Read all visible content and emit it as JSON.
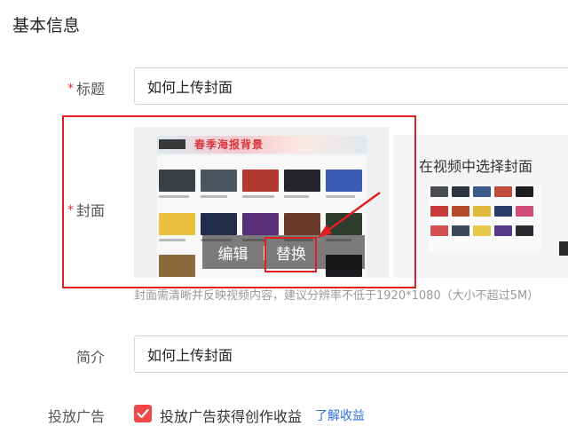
{
  "section": {
    "title": "基本信息"
  },
  "required_mark": "*",
  "title_field": {
    "label": "标题",
    "value": "如何上传封面"
  },
  "cover": {
    "label": "封面",
    "banner_text": "春季海报背景",
    "edit_label": "编辑",
    "replace_label": "替换",
    "tip": "封面需清晰并反映视频内容，建议分辨率不低于1920*1080（大小不超过5M）",
    "video_picker_label": "在视频中选择封面"
  },
  "intro_field": {
    "label": "简介",
    "value": "如何上传封面"
  },
  "ads": {
    "label": "投放广告",
    "checkbox_label": "投放广告获得创作收益",
    "checked": true,
    "link_label": "了解收益"
  },
  "colors": {
    "accent_red": "#e02020",
    "checkbox": "#f04848",
    "link": "#2f6fde"
  }
}
